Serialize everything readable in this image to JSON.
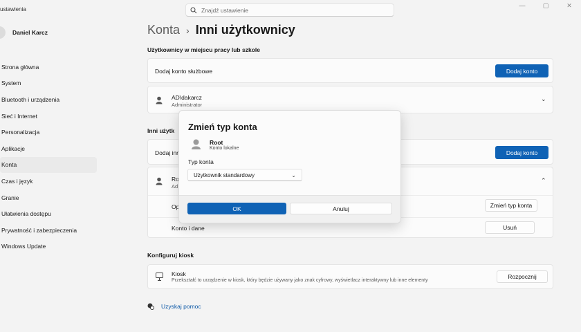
{
  "app": {
    "title": "ustawienia"
  },
  "search": {
    "placeholder": "Znajdź ustawienie"
  },
  "window_controls": {
    "minimize": "—",
    "maximize": "▢",
    "close": "✕"
  },
  "user": {
    "name": "Daniel Karcz"
  },
  "nav": {
    "items": [
      {
        "label": "Strona główna"
      },
      {
        "label": "System"
      },
      {
        "label": "Bluetooth i urządzenia"
      },
      {
        "label": "Sieć i Internet"
      },
      {
        "label": "Personalizacja"
      },
      {
        "label": "Aplikacje"
      },
      {
        "label": "Konta"
      },
      {
        "label": "Czas i język"
      },
      {
        "label": "Granie"
      },
      {
        "label": "Ułatwienia dostępu"
      },
      {
        "label": "Prywatność i zabezpieczenia"
      },
      {
        "label": "Windows Update"
      }
    ]
  },
  "breadcrumb": {
    "parent": "Konta",
    "separator": "›",
    "current": "Inni użytkownicy"
  },
  "work_section": {
    "title": "Użytkownicy w miejscu pracy lub szkole",
    "add_label": "Dodaj konto służbowe",
    "add_button": "Dodaj konto",
    "account": {
      "name": "AD\\dakarcz",
      "role": "Administrator"
    }
  },
  "other_section": {
    "title_partial": "Inni użytk",
    "add_label_partial": "Dodaj inn",
    "add_button": "Dodaj konto",
    "account": {
      "name_partial": "Ro",
      "sub_partial": "Ad"
    },
    "options_label_partial": "Op",
    "change_type_button": "Zmień typ konta",
    "account_data_label": "Konto i dane",
    "remove_button": "Usuń"
  },
  "kiosk_section": {
    "title": "Konfiguruj kiosk",
    "name": "Kiosk",
    "description": "Przekształć to urządzenie w kiosk, który będzie używany jako znak cyfrowy, wyświetlacz interaktywny lub inne elementy",
    "button": "Rozpocznij"
  },
  "help": {
    "link": "Uzyskaj pomoc"
  },
  "dialog": {
    "title": "Zmień typ konta",
    "user_name": "Root",
    "user_sub": "Konto lokalne",
    "field_label": "Typ konta",
    "selected_type": "Użytkownik standardowy",
    "ok_button": "OK",
    "cancel_button": "Anuluj"
  },
  "colors": {
    "accent": "#0f62b5",
    "link": "#0f5aa8",
    "background": "#f3f3f3"
  }
}
